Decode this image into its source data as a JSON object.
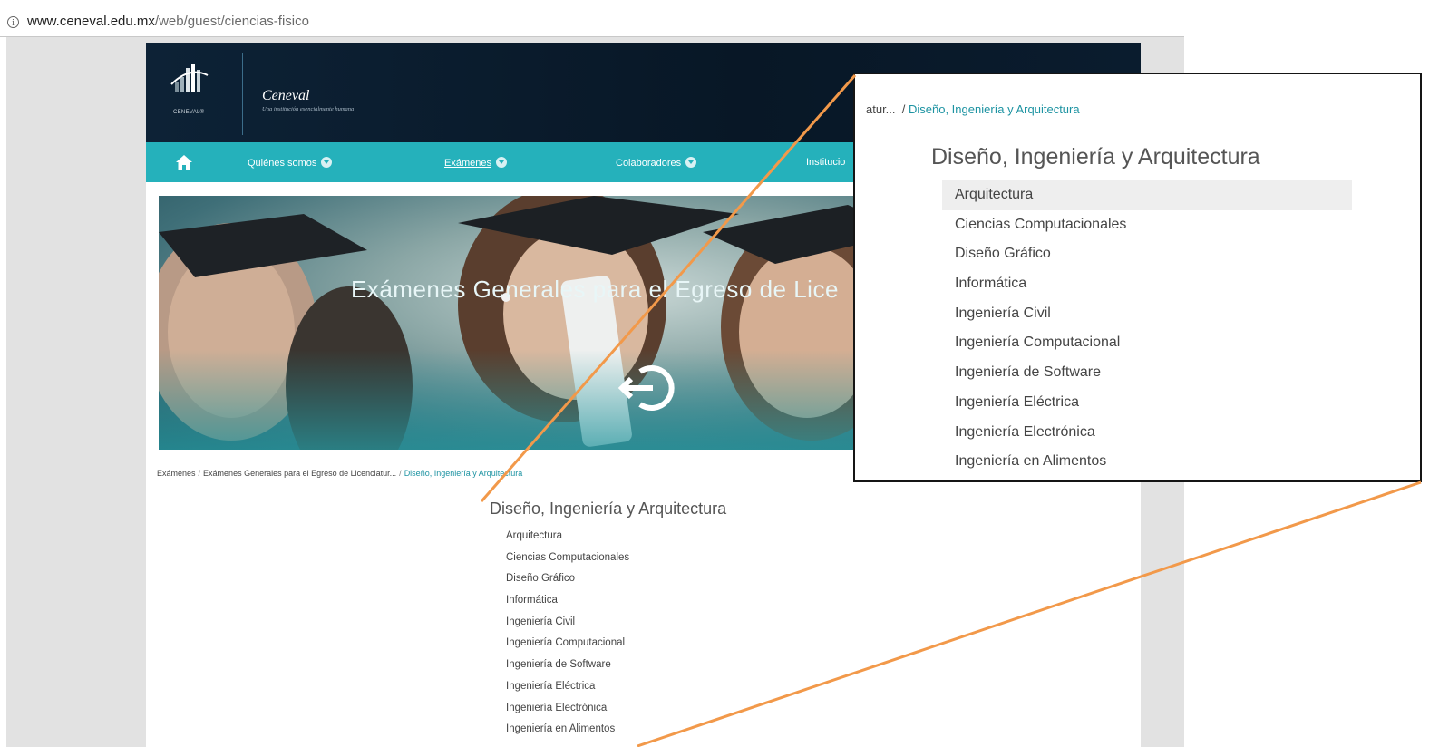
{
  "browser": {
    "url_host": "www.ceneval.edu.mx",
    "url_path": "/web/guest/ciencias-fisico"
  },
  "header": {
    "logo_text": "CENEVAL®",
    "brand_name": "Ceneval",
    "brand_tagline": "Una institución esencialmente humana"
  },
  "nav": {
    "items": [
      "Quiénes somos",
      "Exámenes",
      "Colaboradores",
      "Institucio"
    ]
  },
  "banner": {
    "title": "Exámenes Generales para el Egreso de Lice"
  },
  "breadcrumb": {
    "items": [
      "Exámenes",
      "Exámenes Generales para el Egreso de Licenciatur...",
      "Diseño, Ingeniería y Arquitectura"
    ]
  },
  "section": {
    "title": "Diseño, Ingeniería y Arquitectura",
    "items": [
      "Arquitectura",
      "Ciencias Computacionales",
      "Diseño Gráfico",
      "Informática",
      "Ingeniería Civil",
      "Ingeniería Computacional",
      "Ingeniería de Software",
      "Ingeniería Eléctrica",
      "Ingeniería Electrónica",
      "Ingeniería en Alimentos"
    ]
  },
  "zoom": {
    "crumb_prefix": "atur...",
    "crumb_current": "Diseño, Ingeniería y Arquitectura",
    "title": "Diseño, Ingeniería y Arquitectura",
    "items": [
      "Arquitectura",
      "Ciencias Computacionales",
      "Diseño Gráfico",
      "Informática",
      "Ingeniería Civil",
      "Ingeniería Computacional",
      "Ingeniería de Software",
      "Ingeniería Eléctrica",
      "Ingeniería Electrónica",
      "Ingeniería en Alimentos"
    ]
  },
  "colors": {
    "nav_teal": "#25b1bb",
    "header_navy": "#0a1c2e",
    "link_teal": "#1d93a2",
    "annotation_orange": "#f2994a"
  }
}
